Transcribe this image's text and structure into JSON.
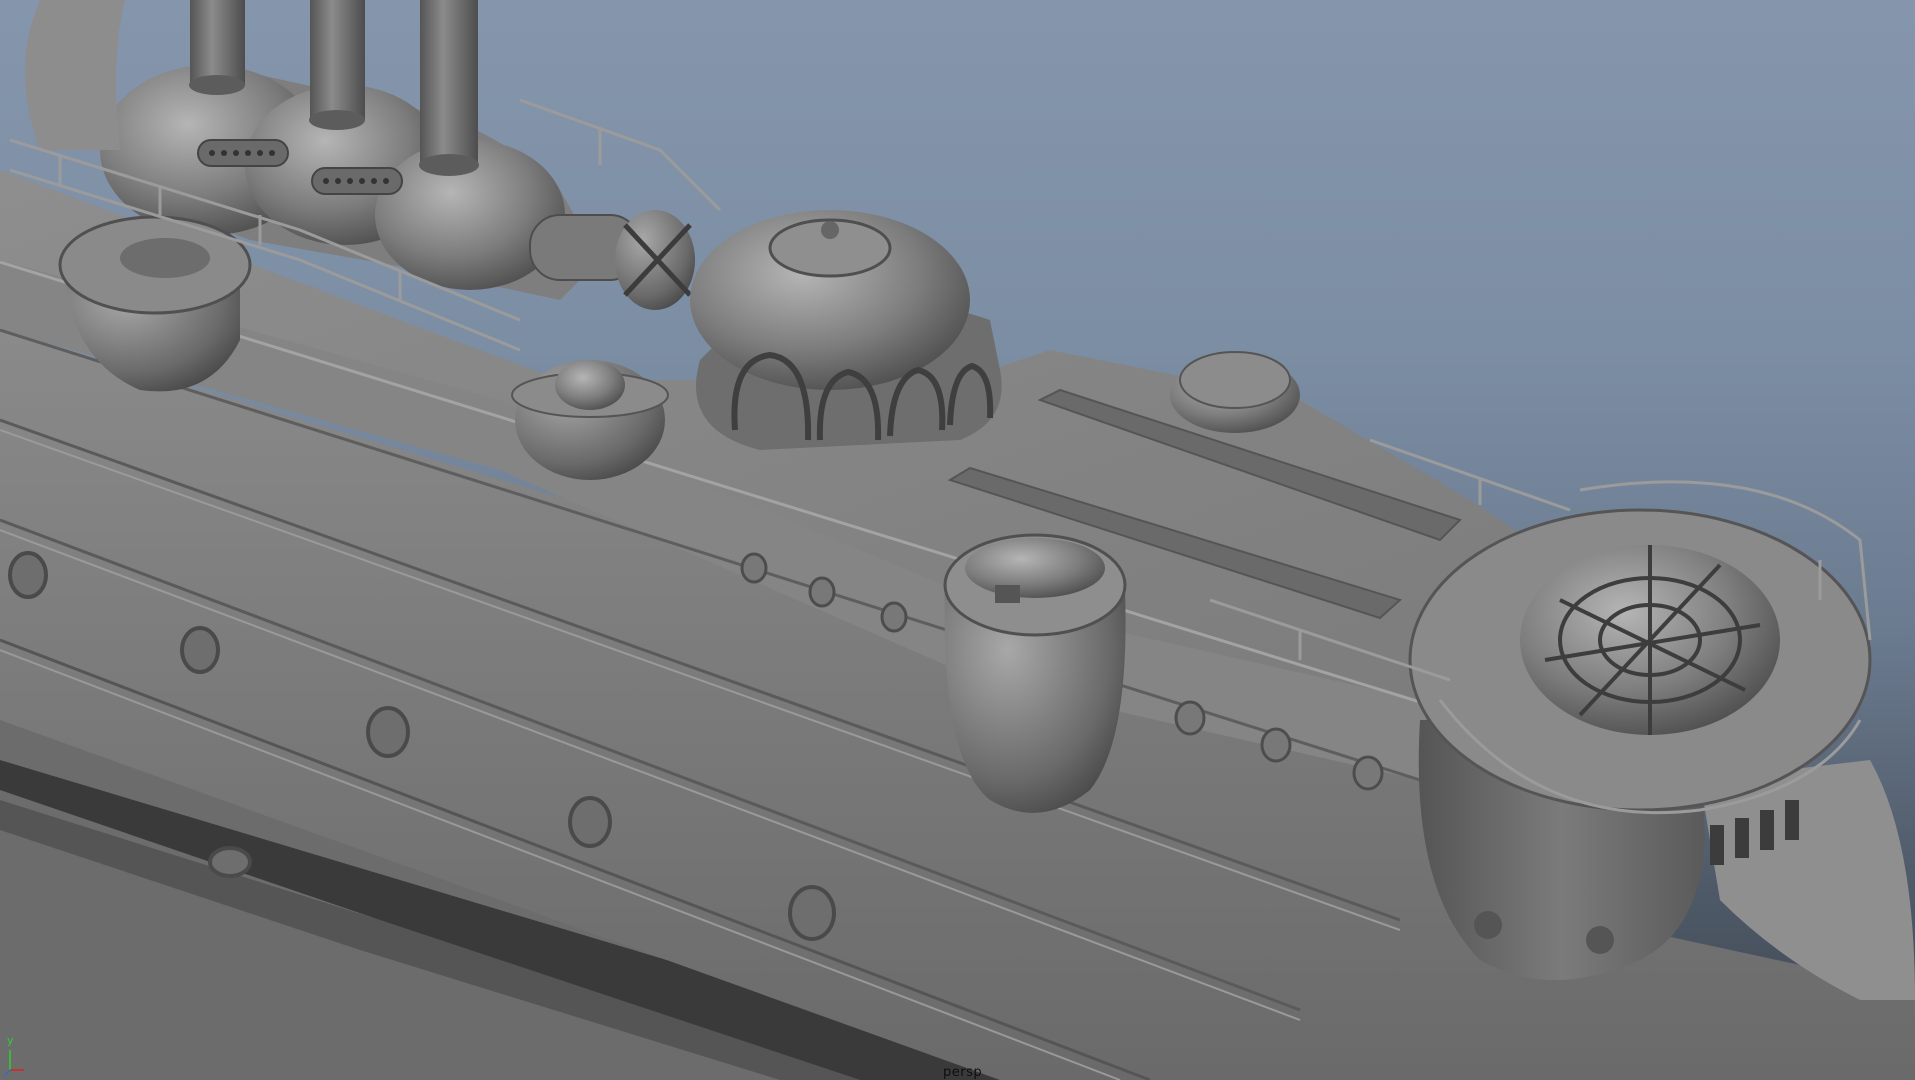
{
  "viewport": {
    "camera_label": "persp",
    "axis_y_label": "y"
  }
}
